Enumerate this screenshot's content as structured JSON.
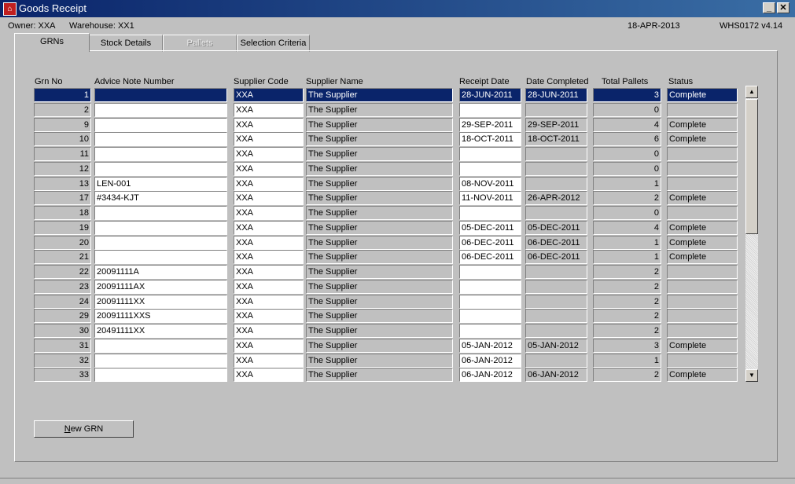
{
  "window": {
    "title": "Goods Receipt",
    "minimize": "_",
    "close": "✕"
  },
  "info": {
    "owner": "Owner:  XXA",
    "warehouse": "Warehouse:  XX1",
    "date": "18-APR-2013",
    "version": "WHS0172  v4.14"
  },
  "tabs": [
    {
      "label": "GRNs",
      "active": true
    },
    {
      "label": "Stock Details"
    },
    {
      "label": "Pallets",
      "disabled": true
    },
    {
      "label": "Selection Criteria"
    }
  ],
  "columns": {
    "grn_no": "Grn No",
    "advice": "Advice Note Number",
    "supplier_code": "Supplier Code",
    "supplier_name": "Supplier Name",
    "receipt_date": "Receipt Date",
    "date_completed": "Date Completed",
    "total_pallets": "Total Pallets",
    "status": "Status"
  },
  "rows": [
    {
      "grn": "1",
      "advice": "",
      "code": "XXA",
      "name": "The Supplier",
      "rdate": "28-JUN-2011",
      "cdate": "28-JUN-2011",
      "total": "3",
      "status": "Complete"
    },
    {
      "grn": "2",
      "advice": "",
      "code": "XXA",
      "name": "The Supplier",
      "rdate": "",
      "cdate": "",
      "total": "0",
      "status": ""
    },
    {
      "grn": "9",
      "advice": "",
      "code": "XXA",
      "name": "The Supplier",
      "rdate": "29-SEP-2011",
      "cdate": "29-SEP-2011",
      "total": "4",
      "status": "Complete"
    },
    {
      "grn": "10",
      "advice": "",
      "code": "XXA",
      "name": "The Supplier",
      "rdate": "18-OCT-2011",
      "cdate": "18-OCT-2011",
      "total": "6",
      "status": "Complete"
    },
    {
      "grn": "11",
      "advice": "",
      "code": "XXA",
      "name": "The Supplier",
      "rdate": "",
      "cdate": "",
      "total": "0",
      "status": ""
    },
    {
      "grn": "12",
      "advice": "",
      "code": "XXA",
      "name": "The Supplier",
      "rdate": "",
      "cdate": "",
      "total": "0",
      "status": ""
    },
    {
      "grn": "13",
      "advice": "LEN-001",
      "code": "XXA",
      "name": "The Supplier",
      "rdate": "08-NOV-2011",
      "cdate": "",
      "total": "1",
      "status": ""
    },
    {
      "grn": "17",
      "advice": "#3434-KJT",
      "code": "XXA",
      "name": "The Supplier",
      "rdate": "11-NOV-2011",
      "cdate": "26-APR-2012",
      "total": "2",
      "status": "Complete"
    },
    {
      "grn": "18",
      "advice": "",
      "code": "XXA",
      "name": "The Supplier",
      "rdate": "",
      "cdate": "",
      "total": "0",
      "status": ""
    },
    {
      "grn": "19",
      "advice": "",
      "code": "XXA",
      "name": "The Supplier",
      "rdate": "05-DEC-2011",
      "cdate": "05-DEC-2011",
      "total": "4",
      "status": "Complete"
    },
    {
      "grn": "20",
      "advice": "",
      "code": "XXA",
      "name": "The Supplier",
      "rdate": "06-DEC-2011",
      "cdate": "06-DEC-2011",
      "total": "1",
      "status": "Complete"
    },
    {
      "grn": "21",
      "advice": "",
      "code": "XXA",
      "name": "The Supplier",
      "rdate": "06-DEC-2011",
      "cdate": "06-DEC-2011",
      "total": "1",
      "status": "Complete"
    },
    {
      "grn": "22",
      "advice": "20091111A",
      "code": "XXA",
      "name": "The Supplier",
      "rdate": "",
      "cdate": "",
      "total": "2",
      "status": ""
    },
    {
      "grn": "23",
      "advice": "20091111AX",
      "code": "XXA",
      "name": "The Supplier",
      "rdate": "",
      "cdate": "",
      "total": "2",
      "status": ""
    },
    {
      "grn": "24",
      "advice": "20091111XX",
      "code": "XXA",
      "name": "The Supplier",
      "rdate": "",
      "cdate": "",
      "total": "2",
      "status": ""
    },
    {
      "grn": "29",
      "advice": "20091111XXS",
      "code": "XXA",
      "name": "The Supplier",
      "rdate": "",
      "cdate": "",
      "total": "2",
      "status": ""
    },
    {
      "grn": "30",
      "advice": "20491111XX",
      "code": "XXA",
      "name": "The Supplier",
      "rdate": "",
      "cdate": "",
      "total": "2",
      "status": ""
    },
    {
      "grn": "31",
      "advice": "",
      "code": "XXA",
      "name": "The Supplier",
      "rdate": "05-JAN-2012",
      "cdate": "05-JAN-2012",
      "total": "3",
      "status": "Complete"
    },
    {
      "grn": "32",
      "advice": "",
      "code": "XXA",
      "name": "The Supplier",
      "rdate": "06-JAN-2012",
      "cdate": "",
      "total": "1",
      "status": ""
    },
    {
      "grn": "33",
      "advice": "",
      "code": "XXA",
      "name": "The Supplier",
      "rdate": "06-JAN-2012",
      "cdate": "06-JAN-2012",
      "total": "2",
      "status": "Complete"
    }
  ],
  "scrollbar": {
    "up": "▲",
    "down": "▼"
  },
  "buttons": {
    "new_grn_underlined": "N",
    "new_grn_rest": "ew GRN"
  },
  "colors": {
    "selection": "#0a246a",
    "titlebar": "#0a246a",
    "background": "#c0c0c0"
  }
}
